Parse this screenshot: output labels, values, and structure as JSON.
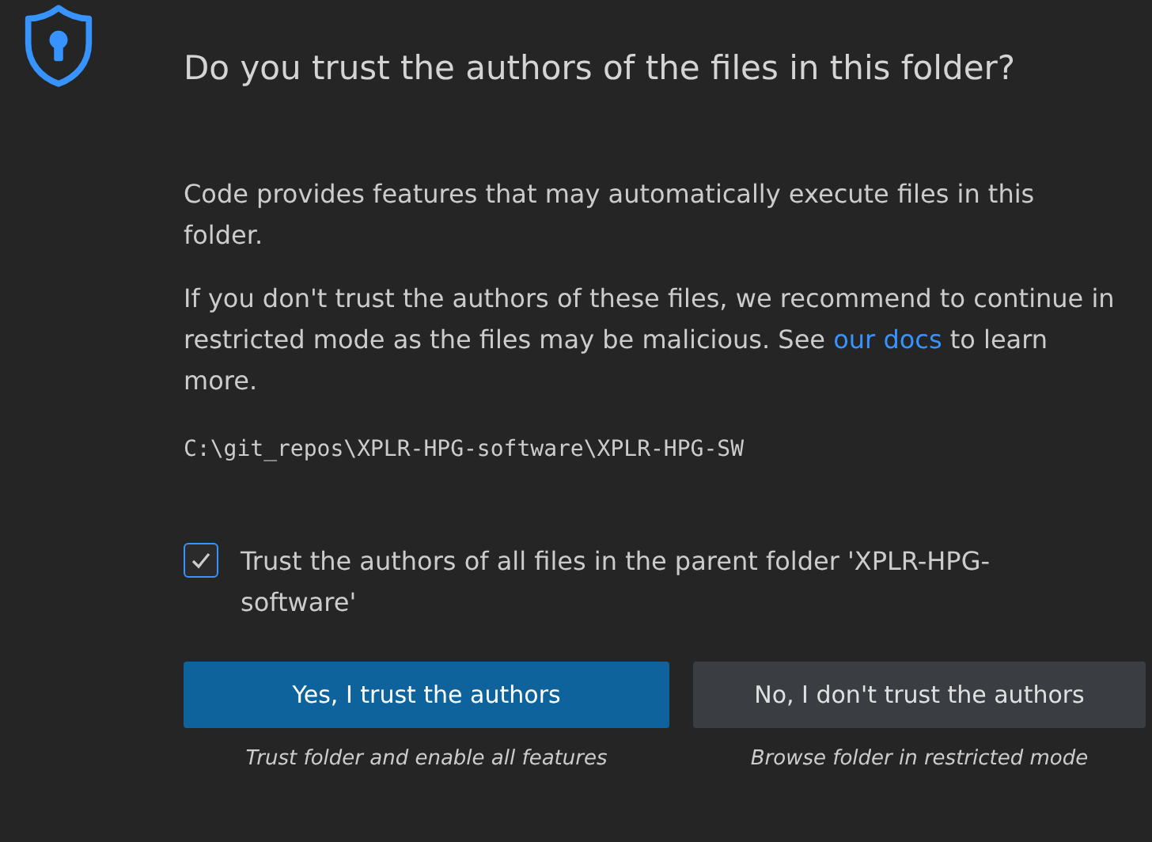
{
  "dialog": {
    "title": "Do you trust the authors of the files in this folder?",
    "paragraphs": [
      {
        "before": "Code provides features that may automatically execute files in this folder."
      },
      {
        "before": "If you don't trust the authors of these files, we recommend to continue in restricted mode as the files may be malicious. See ",
        "link": "our docs",
        "after": " to learn more."
      }
    ],
    "path": "C:\\git_repos\\XPLR-HPG-software\\XPLR-HPG-SW",
    "checkbox": {
      "label": "Trust the authors of all files in the parent folder 'XPLR-HPG-software'",
      "checked": true
    },
    "buttons": [
      {
        "label": "Yes, I trust the authors",
        "caption": "Trust folder and enable all features",
        "kind": "primary"
      },
      {
        "label": "No, I don't trust the authors",
        "caption": "Browse folder in restricted mode",
        "kind": "secondary"
      }
    ]
  }
}
